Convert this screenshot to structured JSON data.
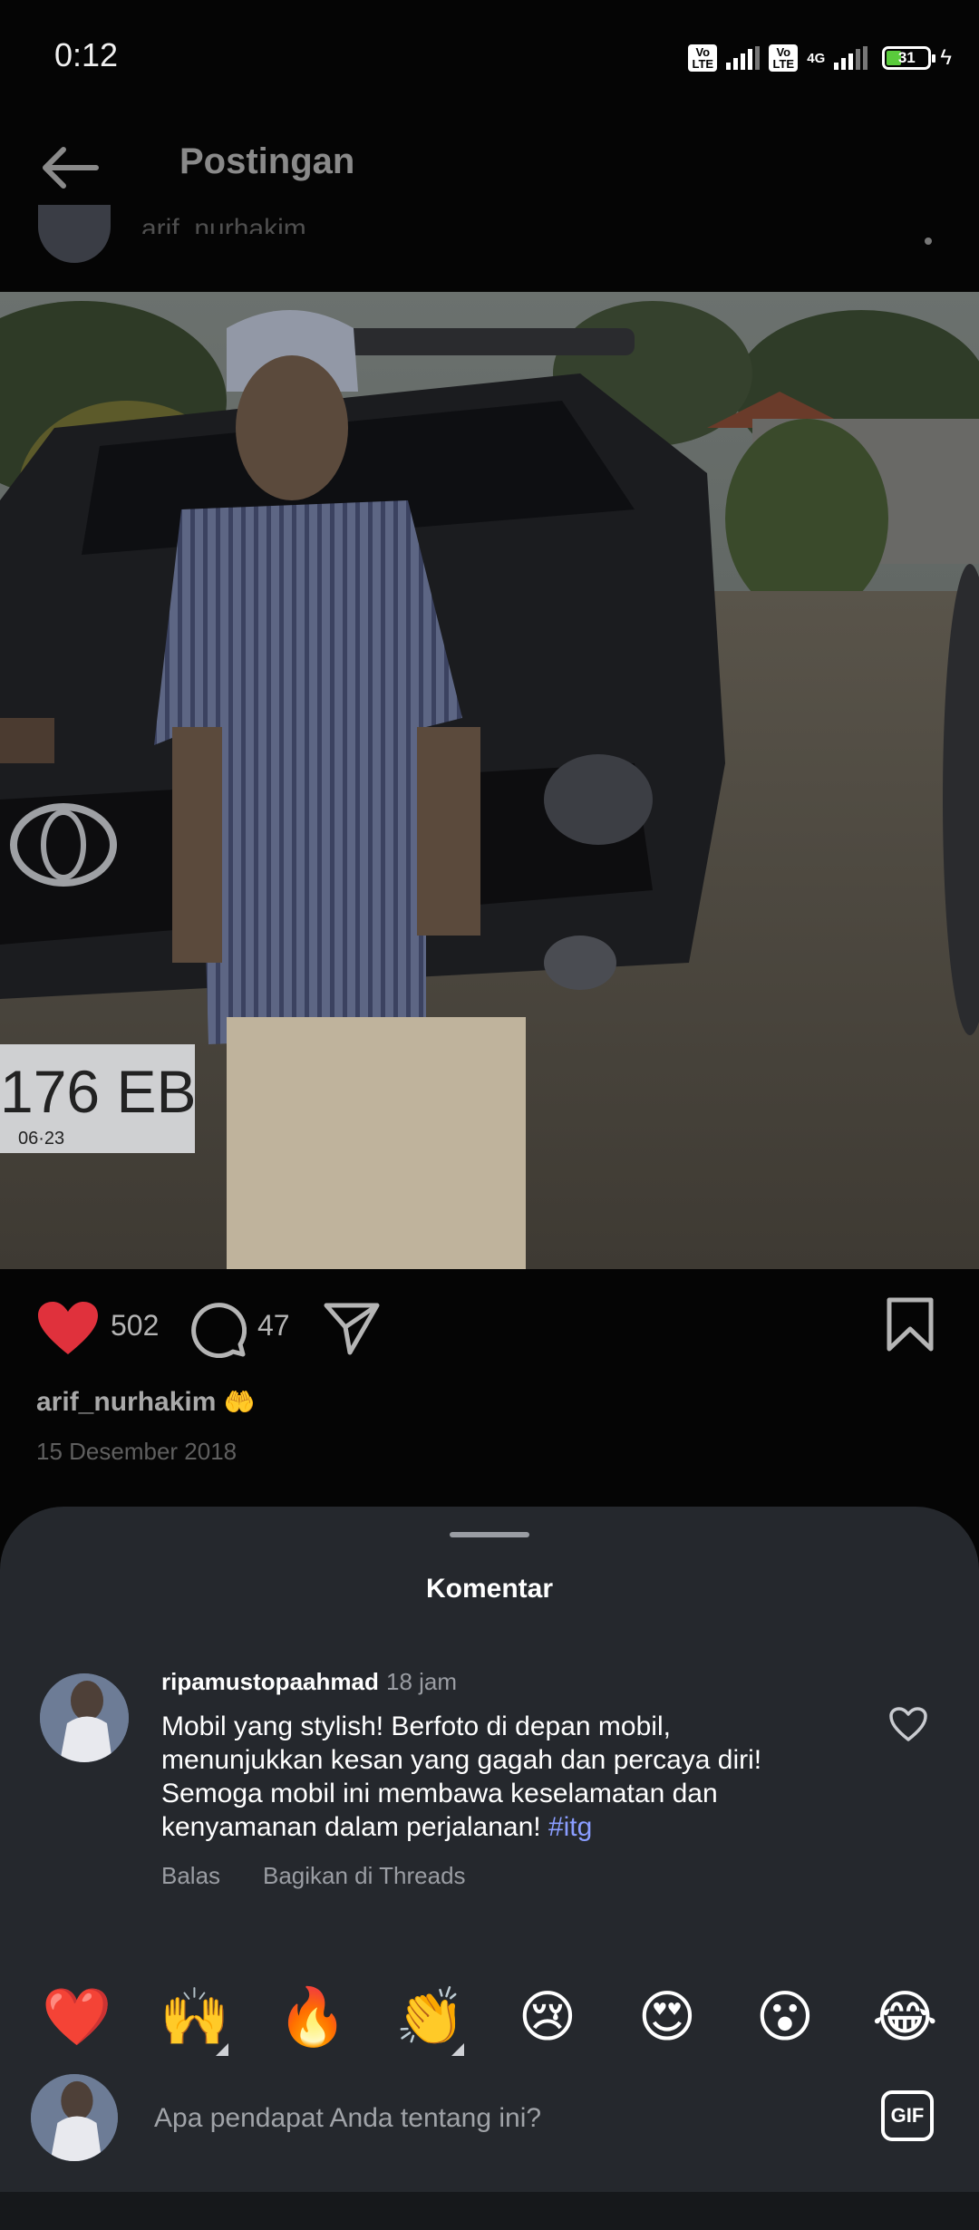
{
  "status_bar": {
    "time": "0:12",
    "volte_label": "Vo LTE",
    "network": "4G",
    "battery_level": "31",
    "signal_bars": [
      1,
      0.75
    ]
  },
  "header": {
    "title": "Postingan",
    "back_icon": "arrow-left-icon"
  },
  "post": {
    "username_partial": "arif_nurhakim",
    "likes": "502",
    "comments": "47",
    "author": "arif_nurhakim",
    "author_emoji": "🤲",
    "date": "15 Desember 2018",
    "plate_text": "176 EB",
    "plate_sub": "06·23",
    "icons": {
      "like": "heart-filled-icon",
      "comment": "comment-bubble-icon",
      "share": "send-icon",
      "save": "bookmark-icon"
    },
    "colors": {
      "liked": "#e0313c"
    }
  },
  "comments": {
    "title": "Komentar",
    "items": [
      {
        "user": "ripamustopaahmad",
        "time": "18 jam",
        "text": "Mobil yang stylish! Berfoto di depan mobil, menunjukkan kesan yang gagah dan percaya diri! Semoga mobil ini membawa keselamatan dan kenyamanan dalam perjalanan!",
        "hashtag": "#itg",
        "reply_label": "Balas",
        "share_label": "Bagikan di Threads"
      }
    ],
    "reactions": [
      "❤️",
      "🙌",
      "🔥",
      "👏",
      "😢",
      "😍",
      "😮",
      "😂"
    ],
    "input_placeholder": "Apa pendapat Anda tentang ini?",
    "gif_label": "GIF",
    "colors": {
      "hashtag": "#8a9dff",
      "sheet_bg": "#25282d"
    }
  }
}
